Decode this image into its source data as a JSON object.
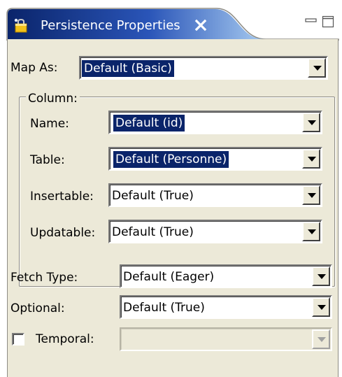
{
  "view": {
    "title": "Persistence Properties",
    "tab_icon": "persistence-properties-icon",
    "close_icon": "close-icon",
    "minimize_icon": "minimize-icon",
    "maximize_icon": "maximize-icon"
  },
  "map_as": {
    "label": "Map As:",
    "value": "Default (Basic)"
  },
  "column_group": {
    "legend": "Column:",
    "name": {
      "label": "Name:",
      "value": "Default (id)"
    },
    "table": {
      "label": "Table:",
      "value": "Default (Personne)"
    },
    "insertable": {
      "label": "Insertable:",
      "value": "Default (True)"
    },
    "updatable": {
      "label": "Updatable:",
      "value": "Default (True)"
    }
  },
  "fetch_type": {
    "label": "Fetch Type:",
    "value": "Default (Eager)"
  },
  "optional": {
    "label": "Optional:",
    "value": "Default (True)"
  },
  "temporal": {
    "label": "Temporal:",
    "checked": false,
    "value": ""
  },
  "colors": {
    "tab_active": "#0a246a",
    "tab_gradient_end": "#a6caf0",
    "panel_bg": "#ece9d8",
    "selection_bg": "#0a246a"
  }
}
